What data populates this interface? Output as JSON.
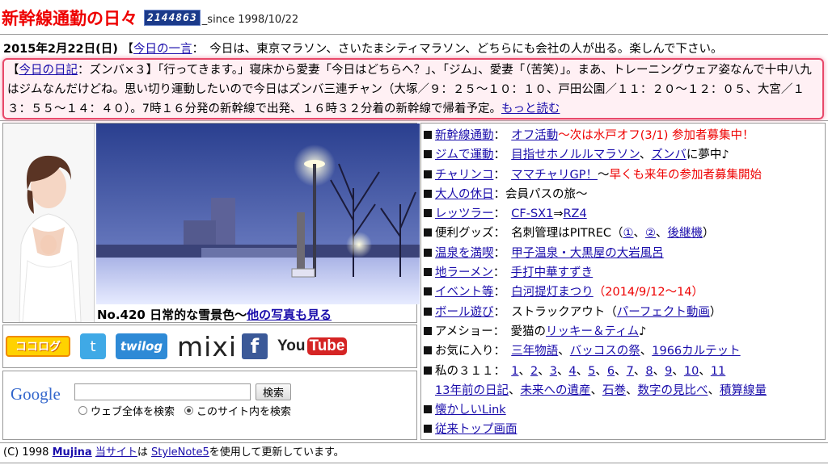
{
  "header": {
    "title": "新幹線通勤の日々",
    "counter": "2144863",
    "since": "_since 1998/10/22"
  },
  "news": {
    "date": "2015年2月22日(日)",
    "hitokoto_open": "【",
    "hitokoto_link": "今日の一言",
    "hitokoto_text": "：　今日は、東京マラソン、さいたまシティマラソン、どちらにも会社の人が出る。楽しんで下さい。",
    "diary_open": "【",
    "diary_link": "今日の日記",
    "diary_text": "：ズンバ×３】「行ってきます。」寝床から愛妻「今日はどちらへ？」、「ジム」、愛妻「（苦笑）」。まあ、トレーニングウェア姿なんで十中八九はジムなんだけどね。思い切り運動したいので今日はズンバ三連チャン（大塚／９：２５～１０：１０、戸田公園／１１：２０～１２：０５、大宮／１３：５５～１４：４０）。7時１６分発の新幹線で出発、１６時３２分着の新幹線で帰着予定。",
    "more_link": "もっと読む"
  },
  "photo": {
    "caption": "No.420 日常的な雪景色～",
    "more_link": "他の写真も見る"
  },
  "social": {
    "cocolog": "ココログ",
    "twitter": "t",
    "twilog": "twilog",
    "mixi": "mixi",
    "facebook": "f",
    "youtube_you": "You",
    "youtube_tube": "Tube"
  },
  "search": {
    "logo": "Google",
    "input_value": "",
    "button": "検索",
    "option_web": "ウェブ全体を検索",
    "option_site": "このサイト内を検索",
    "selected": "site"
  },
  "menu": {
    "m1": {
      "cat": "新幹線通勤",
      "sep": "：",
      "link1": "オフ活動",
      "text": "～次は水戸オフ(3/1) 参加者募集中！"
    },
    "m2": {
      "cat": "ジムで運動",
      "sep": "：",
      "link1": "目指せホノルルマラソン",
      "sep2": "、",
      "link2": "ズンバ",
      "text": "に夢中♪"
    },
    "m3": {
      "cat": "チャリンコ",
      "sep": "：",
      "link1": "ママチャリGP！",
      "text1": "～",
      "text2": "早くも来年の参加者募集開始"
    },
    "m4": {
      "cat": "大人の休日",
      "text": "：会員パスの旅～"
    },
    "m5": {
      "cat": "レッツラー",
      "sep": "：",
      "link1": "CF-SX1",
      "arrow": "⇒",
      "link2": "RZ4"
    },
    "m6": {
      "label": "便利グッズ",
      "text": "：　名刺管理はPITREC（",
      "link1": "①",
      "sep": "、",
      "link2": "②",
      "sep2": "、",
      "link3": "後継機",
      "close": "）"
    },
    "m7": {
      "cat": "温泉を満喫",
      "sep": "：",
      "link1": "甲子温泉・大黒屋の大岩風呂"
    },
    "m8": {
      "cat": "地ラーメン",
      "sep": "：",
      "link1": "手打中華すずき"
    },
    "m9": {
      "cat": "イベント等",
      "sep": "：",
      "link1": "白河提灯まつり",
      "text": "（2014/9/12～14）"
    },
    "m10": {
      "cat": "ボール遊び",
      "text": "：　ストラックアウト（",
      "link1": "パーフェクト動画",
      "close": "）"
    },
    "m11": {
      "label": "アメショー",
      "text": "：　愛猫の",
      "link1": "リッキー＆ティム",
      "note": "♪"
    },
    "m12": {
      "label": "お気に入り",
      "text": "：　",
      "link1": "三年物語",
      "sep": "、",
      "link2": "バッコスの祭",
      "sep2": "、",
      "link3": "1966カルテット"
    },
    "m13": {
      "label": "私の３１１",
      "text": "：",
      "links": [
        "1",
        "2",
        "3",
        "4",
        "5",
        "6",
        "7",
        "8",
        "9",
        "10",
        "11"
      ]
    },
    "m13b": {
      "link1": "13年前の日記",
      "link2": "未来への遺産",
      "link3": "石巻",
      "link4": "数字の見比べ",
      "link5": "積算線量"
    },
    "m14": {
      "cat": "懐かしいLink"
    },
    "m15": {
      "cat": "従来トップ画面"
    }
  },
  "footer": {
    "copy": "(C) 1998 ",
    "author": "Mujina",
    "site_link": "当サイト",
    "mid": "は",
    "tool_link": "StyleNote5",
    "tail": "を使用して更新しています。"
  }
}
